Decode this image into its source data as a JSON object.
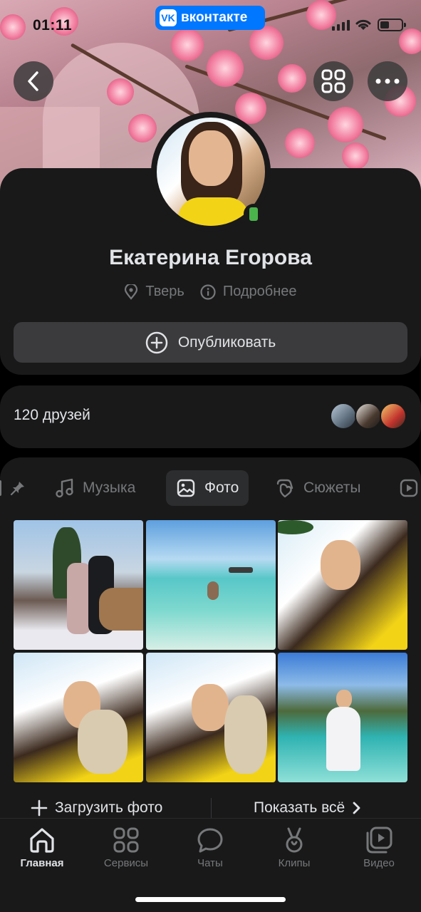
{
  "status_bar": {
    "time": "01:11",
    "app_badge": "вконтакте"
  },
  "profile": {
    "name": "Екатерина Егорова",
    "city": "Тверь",
    "details_label": "Подробнее",
    "publish_label": "Опубликовать"
  },
  "friends": {
    "count_label": "120 друзей"
  },
  "media_tabs": [
    {
      "label": "Музыка",
      "icon": "music-note-icon"
    },
    {
      "label": "Фото",
      "icon": "photo-icon",
      "active": true
    },
    {
      "label": "Сюжеты",
      "icon": "stories-icon"
    }
  ],
  "photo_actions": {
    "upload_label": "Загрузить фото",
    "show_all_label": "Показать всё"
  },
  "tabbar": [
    {
      "label": "Главная",
      "icon": "home-icon",
      "active": true
    },
    {
      "label": "Сервисы",
      "icon": "services-icon"
    },
    {
      "label": "Чаты",
      "icon": "chat-bubble-icon"
    },
    {
      "label": "Клипы",
      "icon": "clips-icon"
    },
    {
      "label": "Видео",
      "icon": "video-icon"
    }
  ],
  "colors": {
    "accent": "#0077ff",
    "online": "#4bb34b",
    "background": "#19191a"
  }
}
